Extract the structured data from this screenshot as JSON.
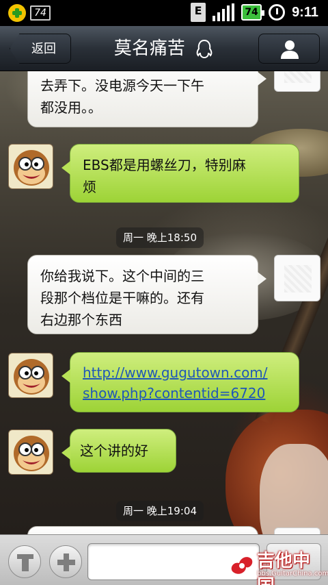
{
  "status_bar": {
    "notification_battery": "74",
    "e_label": "E",
    "battery_level": "74",
    "time": "9:11"
  },
  "header": {
    "back_label": "返回",
    "title": "莫名痛苦"
  },
  "messages": [
    {
      "side": "right",
      "text": "去弄下。没电源今天一下午\n都没用。。"
    },
    {
      "side": "left",
      "text": "EBS都是用螺丝刀，特别麻\n烦"
    },
    {
      "timestamp": "周一 晚上18:50"
    },
    {
      "side": "right",
      "text": "你给我说下。这个中间的三\n段那个档位是干嘛的。还有\n右边那个东西"
    },
    {
      "side": "left",
      "link_line1": "http://www.gugutown.com/",
      "link_line2": "show.php?contentid=6720"
    },
    {
      "side": "left",
      "text": "这个讲的好"
    },
    {
      "timestamp": "周一 晚上19:04"
    }
  ],
  "input": {
    "placeholder": ""
  },
  "watermark": {
    "title": "吉他中国",
    "subtitle": "bbs.GuitarChina.com"
  }
}
